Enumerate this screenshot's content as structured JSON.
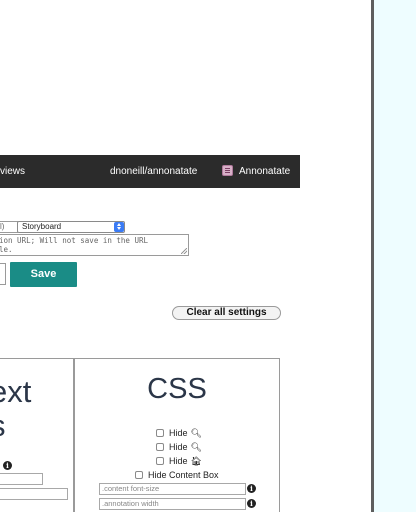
{
  "topbar": {
    "views_label": "views",
    "repo_label": "dnoneill/annonatate",
    "app_icon": "annonatate-app-icon",
    "app_label": "Annonatate"
  },
  "form": {
    "select_stub_text": "l)",
    "select_value": "Storyboard",
    "textarea_value": "ion URL; Will not save in the URL\nle.",
    "save_label": "Save"
  },
  "clear_label": "Clear all settings",
  "left_panel": {
    "heading_line1": "ext",
    "heading_line2": "s",
    "info_glyph": "i"
  },
  "css_panel": {
    "title": "CSS",
    "options": [
      {
        "label": "Hide",
        "glyph": "🔍︎"
      },
      {
        "label": "Hide",
        "glyph": "🔍︎"
      },
      {
        "label": "Hide",
        "glyph": "🏠︎"
      },
      {
        "label": "Hide Content Box",
        "glyph": ""
      }
    ],
    "fields": [
      {
        "placeholder": ".content font-size"
      },
      {
        "placeholder": ".annotation width"
      }
    ],
    "info_glyph": "i"
  },
  "colors": {
    "topbar_bg": "#2b2b2b",
    "save_bg": "#1a8c86",
    "right_pane_bg": "#eefdff"
  }
}
